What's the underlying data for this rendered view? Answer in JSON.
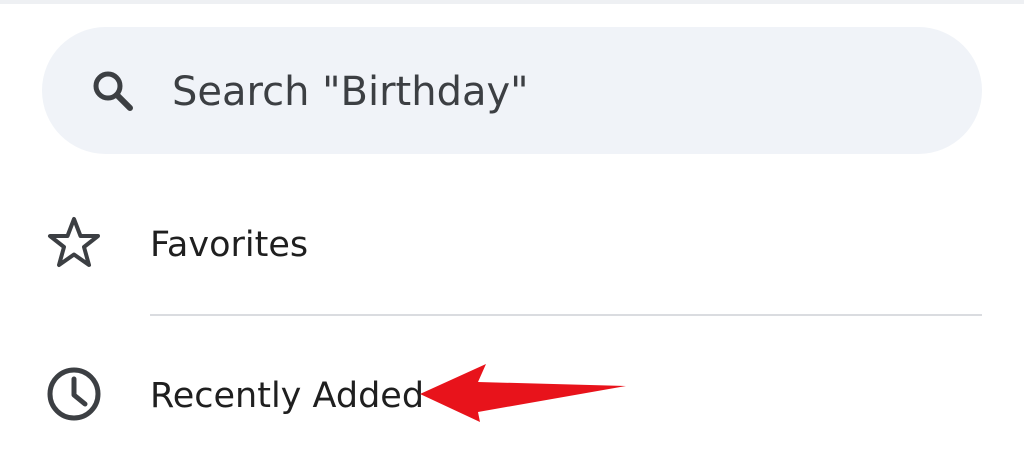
{
  "search": {
    "placeholder": "Search \"Birthday\"",
    "icon": "search-icon"
  },
  "menu": {
    "items": [
      {
        "label": "Favorites",
        "icon": "star-outline-icon"
      },
      {
        "label": "Recently Added",
        "icon": "clock-icon"
      }
    ]
  },
  "annotation": {
    "arrow_color": "#e8131b",
    "points_to": "Recently Added"
  },
  "colors": {
    "search_background": "#f0f3f8",
    "text": "#1f1f1f",
    "divider": "#dadce0"
  }
}
